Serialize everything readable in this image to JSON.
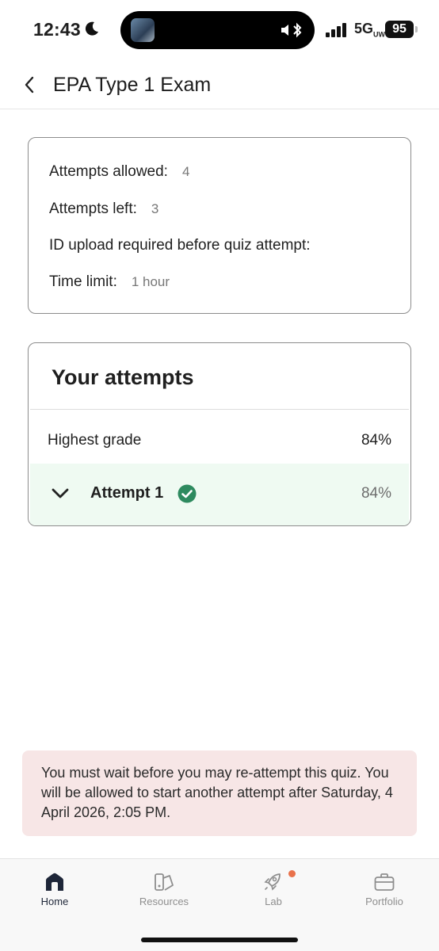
{
  "status": {
    "time": "12:43",
    "network": "5G",
    "network_sub": "UW",
    "battery": "95"
  },
  "header": {
    "title": "EPA Type 1 Exam"
  },
  "info": {
    "attempts_allowed_label": "Attempts allowed:",
    "attempts_allowed_value": "4",
    "attempts_left_label": "Attempts left:",
    "attempts_left_value": "3",
    "id_upload_label": "ID upload required before quiz attempt:",
    "time_limit_label": "Time limit:",
    "time_limit_value": "1 hour"
  },
  "attempts": {
    "title": "Your attempts",
    "highest_grade_label": "Highest grade",
    "highest_grade_value": "84%",
    "items": [
      {
        "label": "Attempt 1",
        "grade": "84%",
        "status": "passed"
      }
    ]
  },
  "notice": {
    "text": "You must wait before you may re-attempt this quiz. You will be allowed to start another attempt after Saturday, 4 April 2026, 2:05 PM."
  },
  "nav": {
    "items": [
      {
        "label": "Home",
        "icon": "home-icon",
        "active": true
      },
      {
        "label": "Resources",
        "icon": "resources-icon",
        "active": false
      },
      {
        "label": "Lab",
        "icon": "rocket-icon",
        "active": false,
        "badge": true
      },
      {
        "label": "Portfolio",
        "icon": "briefcase-icon",
        "active": false
      }
    ]
  },
  "colors": {
    "success": "#2e8a5f",
    "attempt_row_bg": "#effaf2",
    "notice_bg": "#f7e6e6",
    "badge": "#e9724b",
    "nav_active": "#1e2638"
  }
}
